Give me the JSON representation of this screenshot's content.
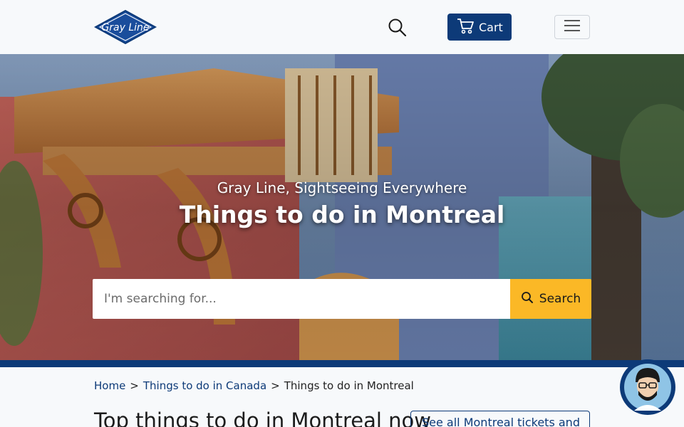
{
  "header": {
    "logo_text": "Gray Line",
    "cart_label": "Cart"
  },
  "hero": {
    "subtitle": "Gray Line, Sightseeing Everywhere",
    "title": "Things to do in Montreal"
  },
  "search": {
    "placeholder": "I'm searching for...",
    "button_label": "Search"
  },
  "breadcrumb": {
    "items": [
      "Home",
      "Things to do in Canada",
      "Things to do in Montreal"
    ],
    "separator": ">"
  },
  "main": {
    "section_title": "Top things to do in Montreal now",
    "see_all_label": "See all Montreal tickets and"
  },
  "colors": {
    "brand_blue": "#0d3a78",
    "search_button": "#fbb826"
  }
}
